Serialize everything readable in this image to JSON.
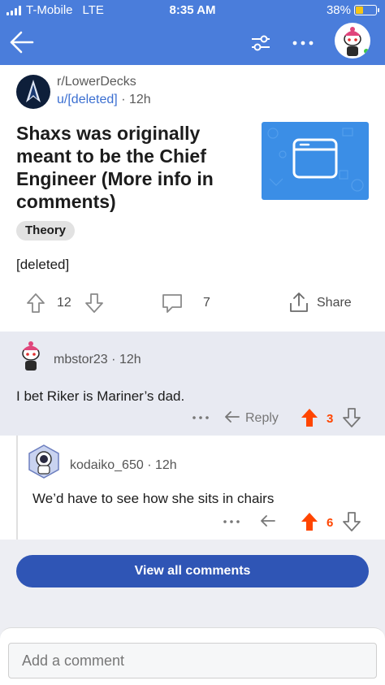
{
  "status_bar": {
    "carrier": "T-Mobile",
    "network": "LTE",
    "time": "8:35 AM",
    "battery": "38%"
  },
  "header": {
    "back_icon": "arrow-left-icon",
    "filter_icon": "sort-filter-icon",
    "more_icon": "more-horizontal-icon",
    "avatar_icon": "snoo-avatar-icon"
  },
  "post": {
    "subreddit": "r/LowerDecks",
    "author": "u/[deleted]",
    "time": "12h",
    "title": "Shaxs was originally meant to be the Chief Engineer (More info in comments)",
    "flair": "Theory",
    "body": "[deleted]",
    "votes": "12",
    "comments": "7",
    "share_label": "Share",
    "thumbnail_icon": "browser-window-icon"
  },
  "comments": [
    {
      "author": "mbstor23",
      "time": "12h",
      "text": "I bet Riker is Mariner’s dad.",
      "reply_label": "Reply",
      "votes": "3"
    },
    {
      "author": "kodaiko_650",
      "time": "12h",
      "text": "We’d have to see how she sits in chairs",
      "votes": "6"
    }
  ],
  "view_all_label": "View all comments",
  "composer": {
    "placeholder": "Add a comment"
  },
  "colors": {
    "header": "#4a7ddb",
    "upvoted": "#ff4500",
    "link": "#3b6fd1",
    "button": "#2f55b5"
  }
}
